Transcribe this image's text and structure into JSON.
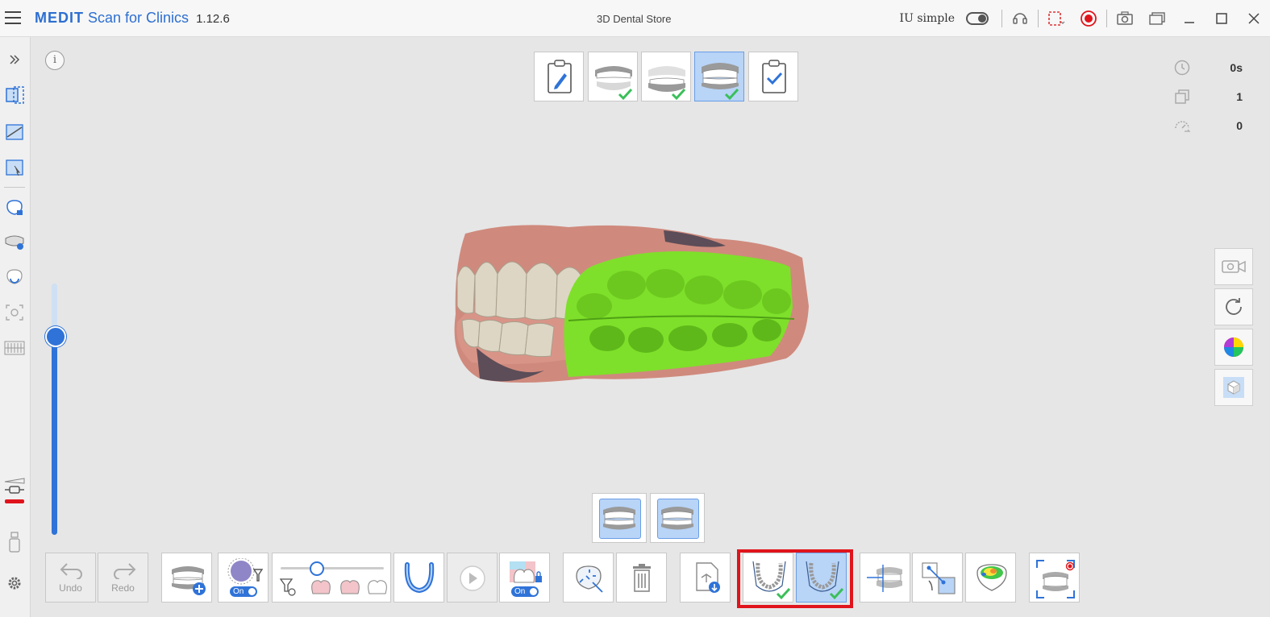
{
  "titlebar": {
    "brand": "MEDIT",
    "app_name": "Scan for Clinics",
    "version": "1.12.6",
    "store": "3D Dental Store",
    "mode_label": "IU simple"
  },
  "stats": {
    "time": "0s",
    "shots": "1",
    "count": "0"
  },
  "bottom_toolbar": {
    "undo_label": "Undo",
    "redo_label": "Redo",
    "filter_on": "On",
    "lock_on": "On"
  },
  "colors": {
    "accent": "#2d6fd1",
    "highlight_box": "#e0141c",
    "selected_bg": "#b8d4f7",
    "scan_green": "#7ee02a"
  }
}
